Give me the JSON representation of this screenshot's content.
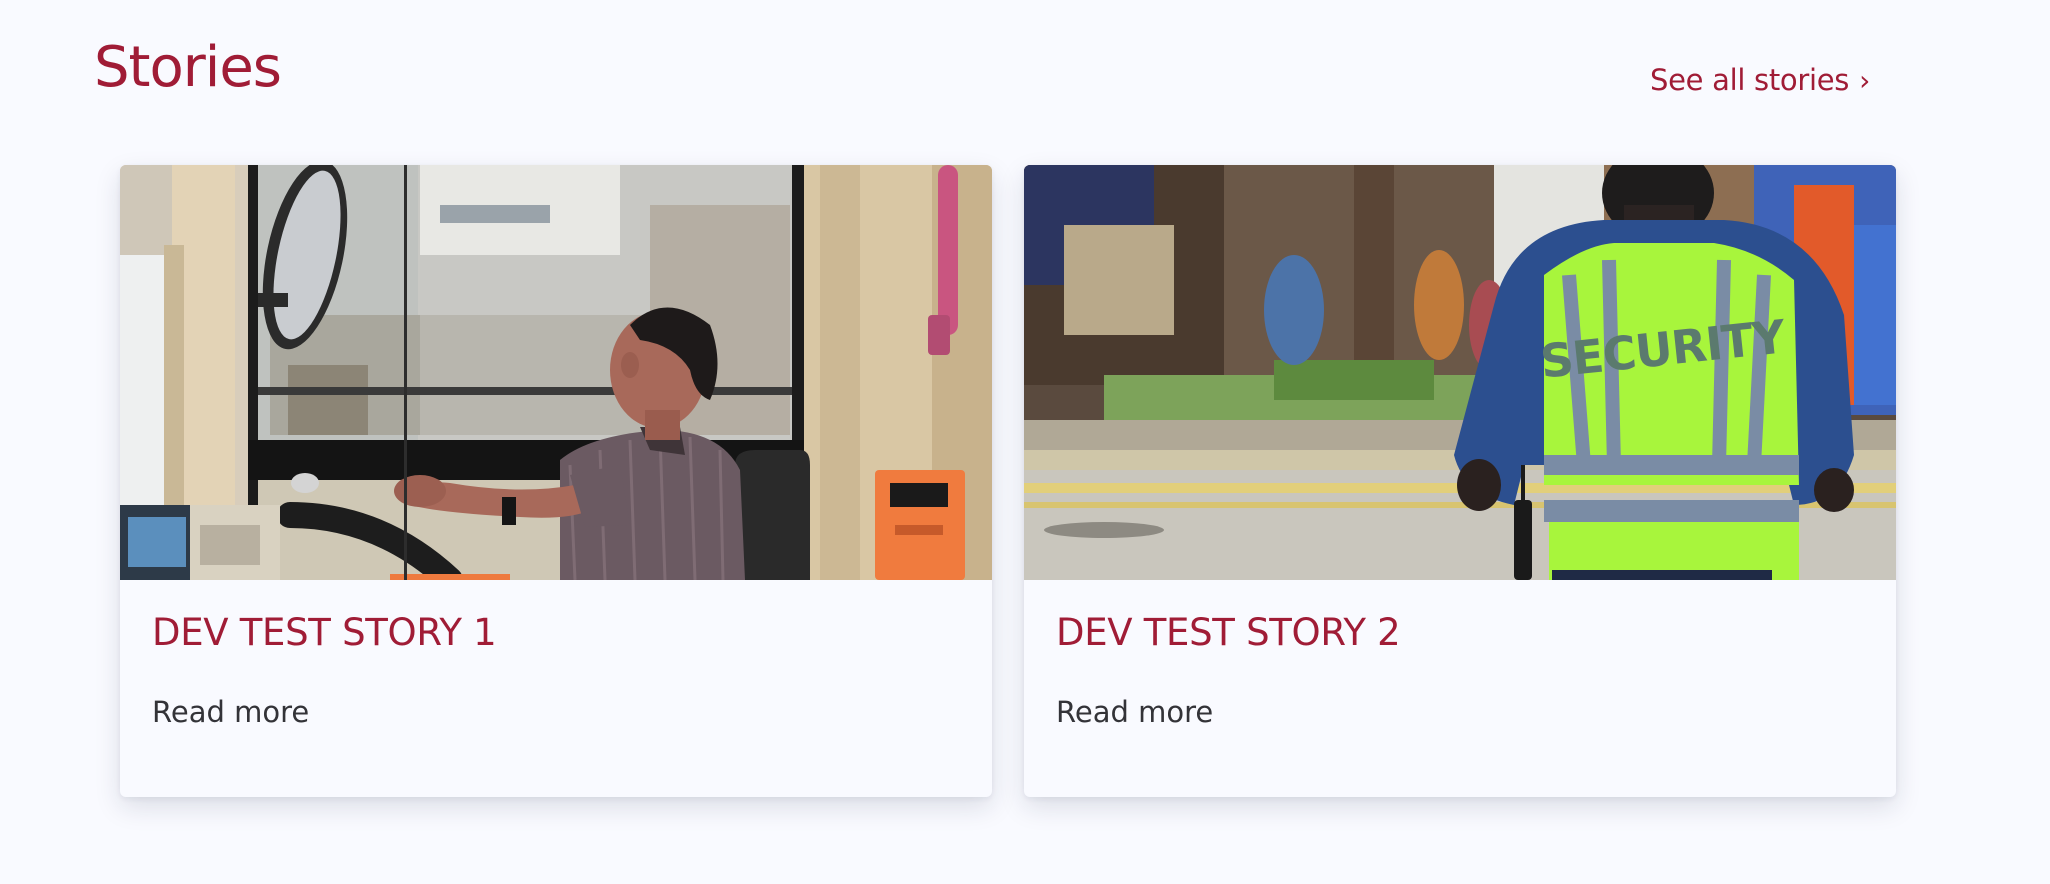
{
  "header": {
    "title": "Stories",
    "see_all_label": "See all stories",
    "see_all_icon": "chevron-right-icon"
  },
  "stories": [
    {
      "title": "DEV TEST STORY 1",
      "link_label": "Read more",
      "image": "bus-driver-photo"
    },
    {
      "title": "DEV TEST STORY 2",
      "link_label": "Read more",
      "image": "security-guard-photo",
      "image_text": "SECURITY"
    }
  ],
  "colors": {
    "accent": "#a01c36",
    "background": "#f9faff",
    "body_text": "#333338"
  }
}
